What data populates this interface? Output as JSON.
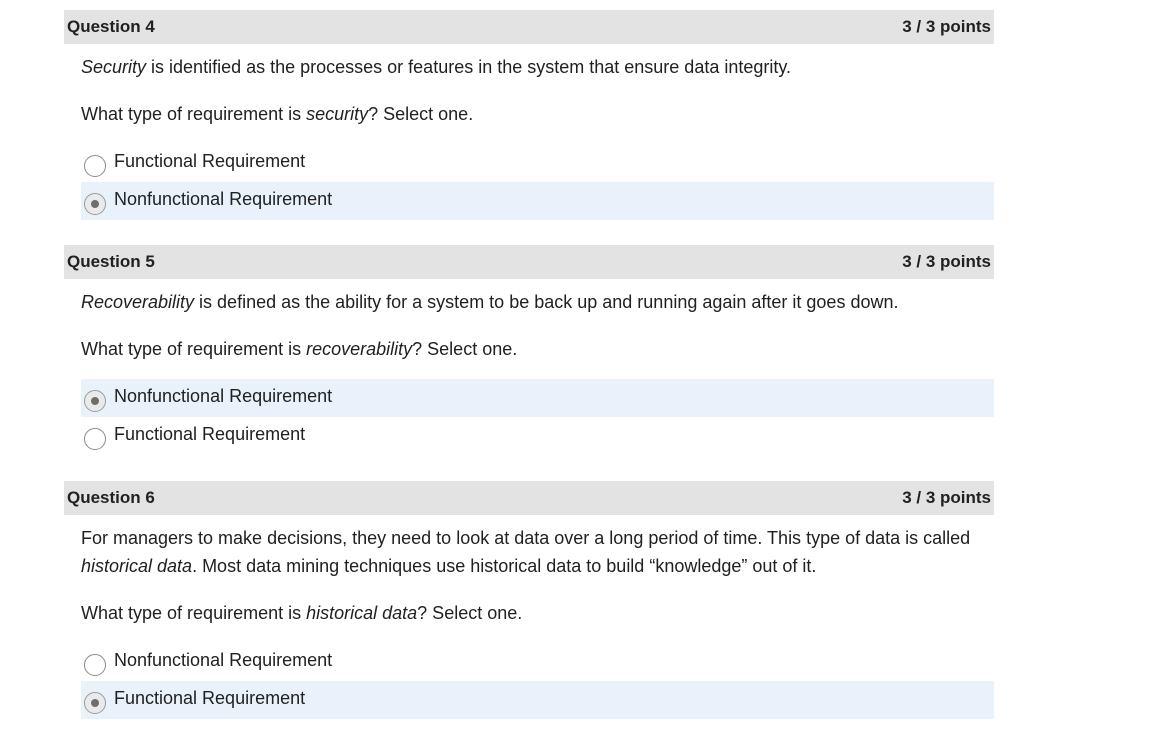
{
  "questions": [
    {
      "title": "Question 4",
      "score": "3 / 3 points",
      "statement": {
        "term": "Security",
        "rest": " is identified as the processes or features in the system that ensure data integrity."
      },
      "prompt": {
        "before": "What type of requirement is ",
        "term": "security",
        "after": "? Select one."
      },
      "options": [
        {
          "label": "Functional Requirement",
          "selected": false
        },
        {
          "label": "Nonfunctional Requirement",
          "selected": true
        }
      ]
    },
    {
      "title": "Question 5",
      "score": "3 / 3 points",
      "statement": {
        "term": "Recoverability",
        "rest": " is defined as the ability for a system to be back up and running again after it goes down."
      },
      "prompt": {
        "before": "What type of requirement is ",
        "term": "recoverability",
        "after": "? Select one."
      },
      "options": [
        {
          "label": "Nonfunctional Requirement",
          "selected": true
        },
        {
          "label": "Functional Requirement",
          "selected": false
        }
      ]
    },
    {
      "title": "Question 6",
      "score": "3 / 3 points",
      "statement": {
        "before": "For managers to make decisions, they need to look at data over a long period of time. This type of data is called ",
        "term": "historical data",
        "rest": ". Most data mining techniques use historical data to build “knowledge” out of it."
      },
      "prompt": {
        "before": "What type of requirement is ",
        "term": "historical data",
        "after": "? Select one."
      },
      "options": [
        {
          "label": "Nonfunctional Requirement",
          "selected": false
        },
        {
          "label": "Functional Requirement",
          "selected": true
        }
      ]
    }
  ]
}
